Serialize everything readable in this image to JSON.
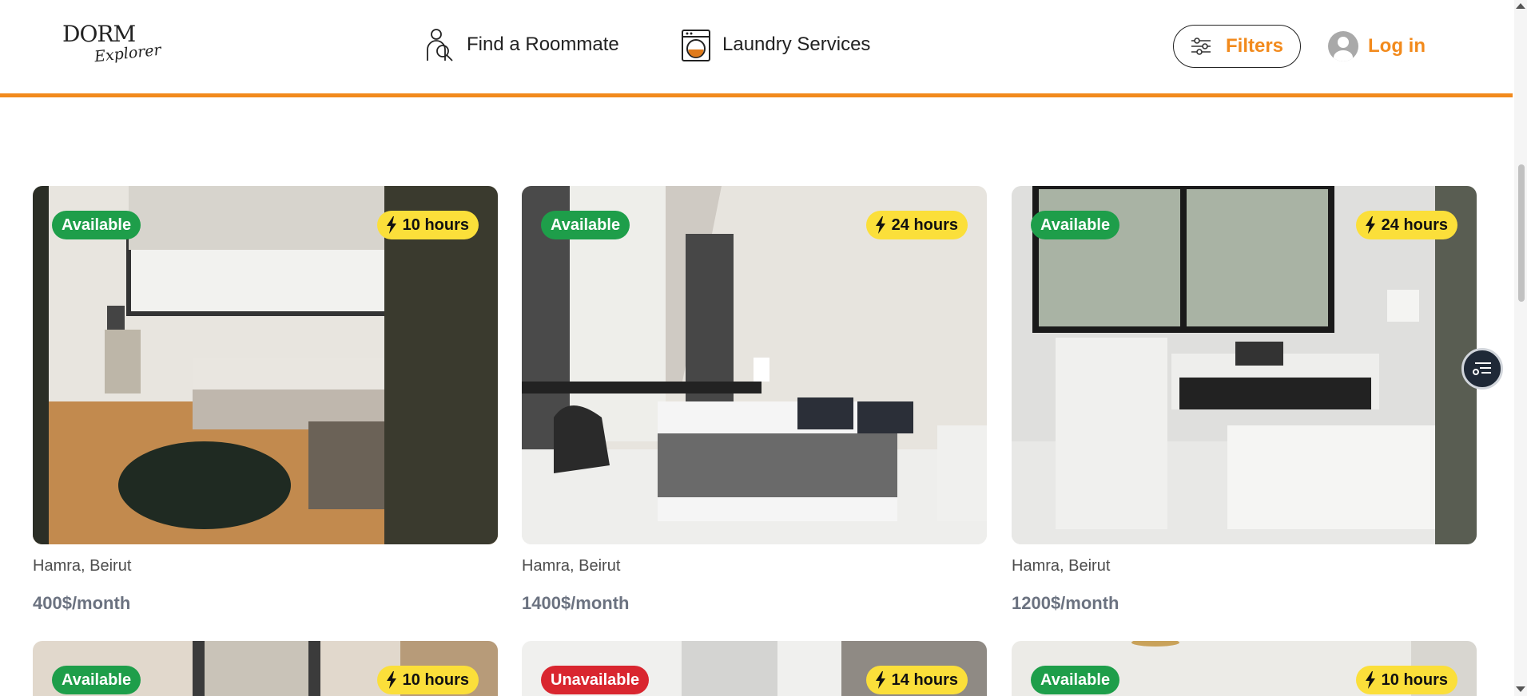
{
  "header": {
    "logo_text_top": "DORM",
    "logo_text_bottom": "Explorer",
    "nav": [
      {
        "label": "Find a Roommate",
        "icon": "roommate-search-icon"
      },
      {
        "label": "Laundry Services",
        "icon": "washing-machine-icon"
      }
    ],
    "filters_label": "Filters",
    "login_label": "Log in",
    "accent_color": "#f28a1c"
  },
  "listings": [
    {
      "status": "Available",
      "response_time": "10 hours",
      "location": "Hamra, Beirut",
      "price": "400$/month"
    },
    {
      "status": "Available",
      "response_time": "24 hours",
      "location": "Hamra, Beirut",
      "price": "1400$/month"
    },
    {
      "status": "Available",
      "response_time": "24 hours",
      "location": "Hamra, Beirut",
      "price": "1200$/month"
    },
    {
      "status": "Available",
      "response_time": "10 hours"
    },
    {
      "status": "Unavailable",
      "response_time": "14 hours"
    },
    {
      "status": "Available",
      "response_time": "10 hours"
    }
  ],
  "colors": {
    "available": "#1e9e4a",
    "unavailable": "#d9262f",
    "time_badge": "#fbdf3a"
  },
  "icons": {
    "bolt": "lightning-bolt-icon",
    "filters": "sliders-icon",
    "user": "user-avatar-icon",
    "fab": "list-filter-icon"
  }
}
